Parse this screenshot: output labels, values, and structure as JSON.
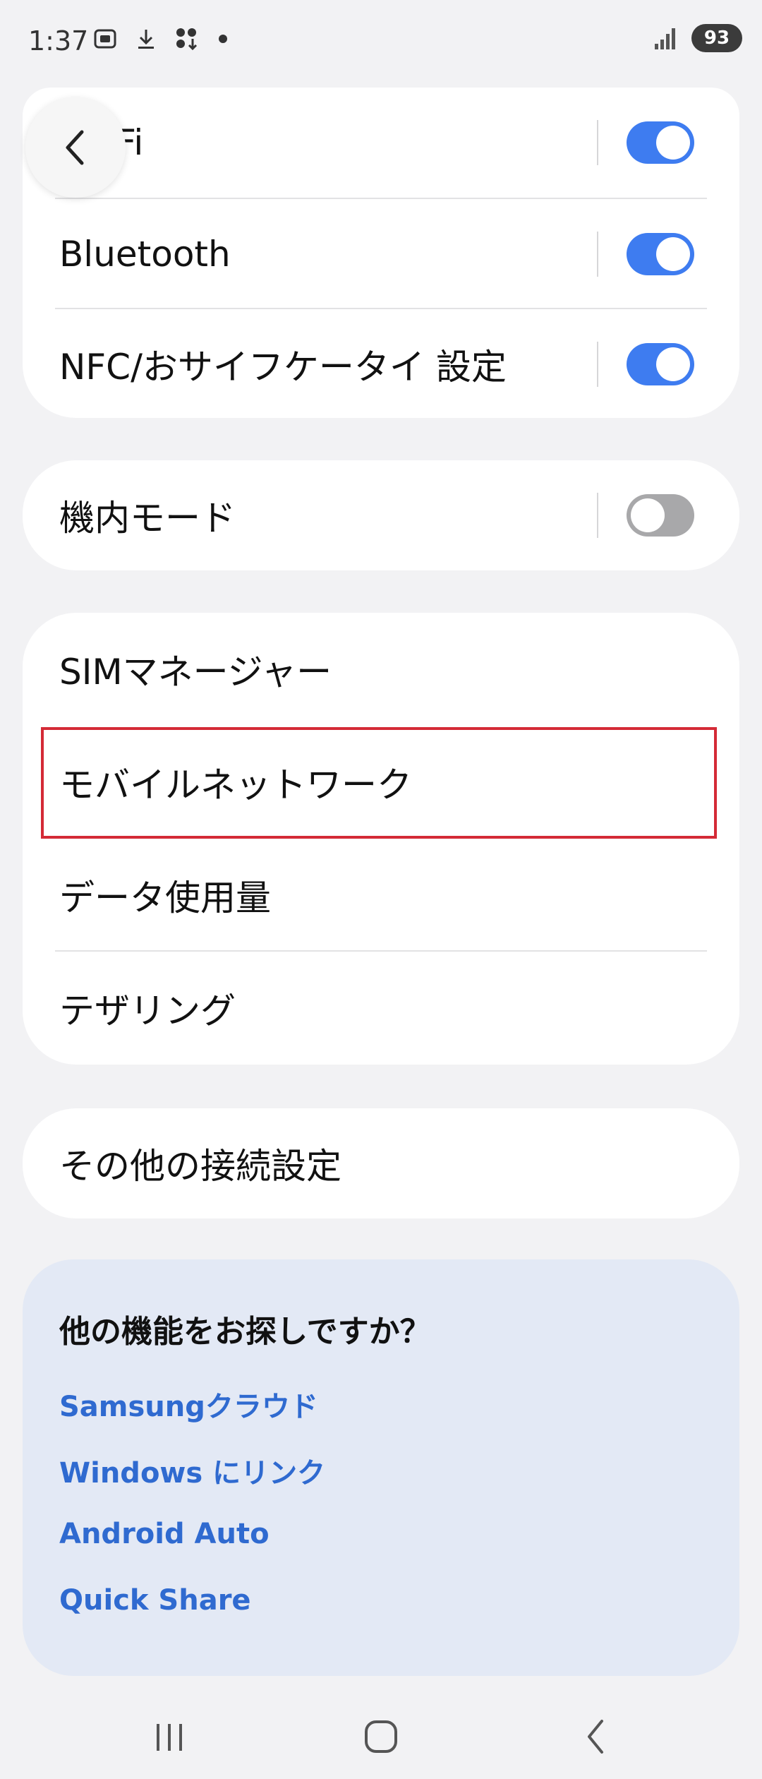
{
  "status_bar": {
    "time": "1:37",
    "battery": "93",
    "icons": [
      "screenshot-icon",
      "download-icon",
      "apps-download-icon",
      "notification-dot-icon",
      "signal-icon"
    ]
  },
  "network_card": {
    "items": [
      {
        "label": "Wi-Fi",
        "toggle": "on"
      },
      {
        "label": "Bluetooth",
        "toggle": "on"
      },
      {
        "label": "NFC/おサイフケータイ 設定",
        "toggle": "on"
      }
    ]
  },
  "airplane_card": {
    "label": "機内モード",
    "toggle": "off"
  },
  "sim_card": {
    "items": [
      {
        "label": "SIMマネージャー"
      },
      {
        "label": "モバイルネットワーク",
        "highlighted": true
      },
      {
        "label": "データ使用量"
      },
      {
        "label": "テザリング"
      }
    ]
  },
  "other_card": {
    "label": "その他の接続設定"
  },
  "suggestions": {
    "title": "他の機能をお探しですか？",
    "links": [
      "Samsungクラウド",
      "Windows にリンク",
      "Android Auto",
      "Quick Share"
    ]
  },
  "colors": {
    "accent": "#3e7cf0",
    "link": "#2f6ad0",
    "highlight_border": "#d42a36",
    "toggle_off": "#a8a8aa",
    "background": "#f2f2f4",
    "suggestion_bg": "#e3e9f5"
  },
  "nav_bar": {
    "buttons": [
      "recent-apps-icon",
      "home-icon",
      "back-icon"
    ]
  }
}
